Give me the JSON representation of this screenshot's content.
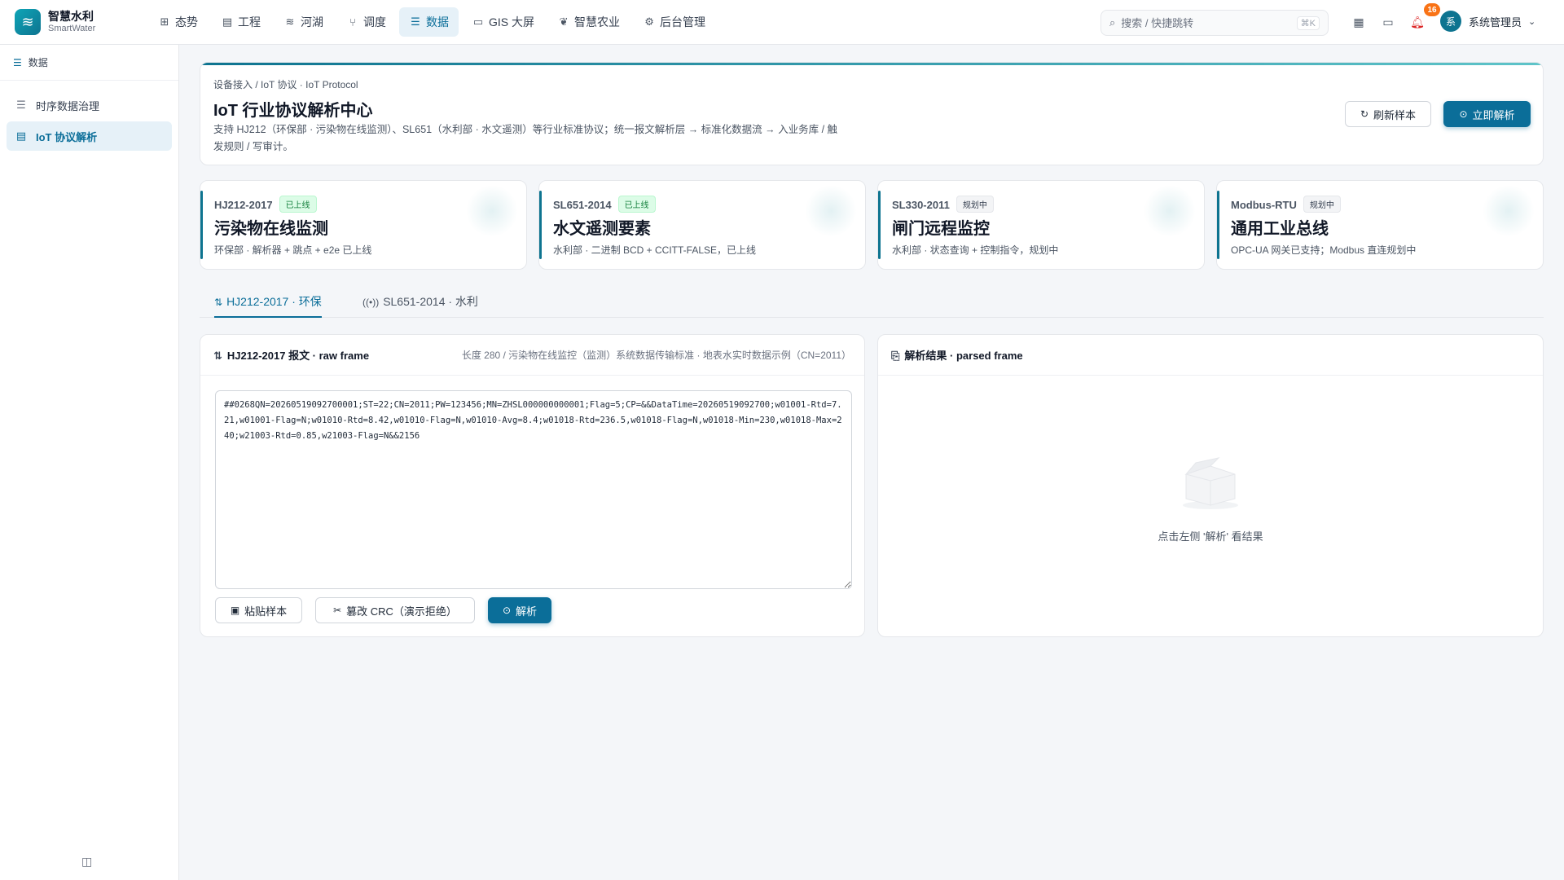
{
  "brand": {
    "title": "智慧水利",
    "subtitle": "SmartWater",
    "logo_icon": "water-waves-icon"
  },
  "nav": [
    {
      "label": "态势",
      "icon": "grid-icon",
      "glyph": "⊞"
    },
    {
      "label": "工程",
      "icon": "building-icon",
      "glyph": "▤"
    },
    {
      "label": "河湖",
      "icon": "waves-icon",
      "glyph": "≋"
    },
    {
      "label": "调度",
      "icon": "branch-icon",
      "glyph": "⑂"
    },
    {
      "label": "数据",
      "icon": "database-icon",
      "glyph": "☰",
      "active": true
    },
    {
      "label": "GIS 大屏",
      "icon": "monitor-icon",
      "glyph": "▭"
    },
    {
      "label": "智慧农业",
      "icon": "sprout-icon",
      "glyph": "❦"
    },
    {
      "label": "后台管理",
      "icon": "settings-icon",
      "glyph": "⚙"
    }
  ],
  "search": {
    "placeholder": "搜索 / 快捷跳转",
    "shortcut": "⌘K"
  },
  "notifications": {
    "count": "16"
  },
  "user": {
    "avatar_text": "系",
    "name": "系统管理员"
  },
  "sidebar": {
    "section": "数据",
    "items": [
      {
        "label": "时序数据治理",
        "icon": "database-icon"
      },
      {
        "label": "IoT 协议解析",
        "icon": "server-icon",
        "active": true
      }
    ]
  },
  "header": {
    "breadcrumb": "设备接入 / IoT 协议 · IoT Protocol",
    "title": "IoT 行业协议解析中心",
    "description": "支持 HJ212（环保部 · 污染物在线监测）、SL651（水利部 · 水文遥测）等行业标准协议；统一报文解析层 → 标准化数据流 → 入业务库 / 触发规则 / 写审计。",
    "refresh_label": "刷新样本",
    "parse_now_label": "立即解析"
  },
  "protocols": [
    {
      "code": "HJ212-2017",
      "status": "已上线",
      "status_kind": "online",
      "title": "污染物在线监测",
      "sub": "环保部 · 解析器 + 跳点 + e2e 已上线"
    },
    {
      "code": "SL651-2014",
      "status": "已上线",
      "status_kind": "online",
      "title": "水文遥测要素",
      "sub": "水利部 · 二进制 BCD + CCITT-FALSE，已上线"
    },
    {
      "code": "SL330-2011",
      "status": "规划中",
      "status_kind": "plan",
      "title": "闸门远程监控",
      "sub": "水利部 · 状态查询 + 控制指令，规划中"
    },
    {
      "code": "Modbus-RTU",
      "status": "规划中",
      "status_kind": "plan",
      "title": "通用工业总线",
      "sub": "OPC-UA 网关已支持；Modbus 直连规划中"
    }
  ],
  "tabs": [
    {
      "label": "HJ212-2017 · 环保",
      "active": true
    },
    {
      "label": "SL651-2014 · 水利"
    }
  ],
  "raw_panel": {
    "title": "HJ212-2017 报文 · raw frame",
    "meta": "长度 280 / 污染物在线监控（监测）系统数据传输标准 · 地表水实时数据示例（CN=2011）",
    "frame": "##0268QN=20260519092700001;ST=22;CN=2011;PW=123456;MN=ZHSL000000000001;Flag=5;CP=&&DataTime=20260519092700;w01001-Rtd=7.21,w01001-Flag=N;w01010-Rtd=8.42,w01010-Flag=N,w01010-Avg=8.4;w01018-Rtd=236.5,w01018-Flag=N,w01018-Min=230,w01018-Max=240;w21003-Rtd=0.85,w21003-Flag=N&&2156",
    "paste_label": "粘贴样本",
    "tamper_label": "篡改 CRC（演示拒绝）",
    "parse_label": "解析"
  },
  "result_panel": {
    "title": "解析结果 · parsed frame",
    "empty_text": "点击左侧 '解析' 看结果"
  },
  "colors": {
    "accent": "#0b6e99",
    "online": "#15803d",
    "notify": "#f97316"
  }
}
